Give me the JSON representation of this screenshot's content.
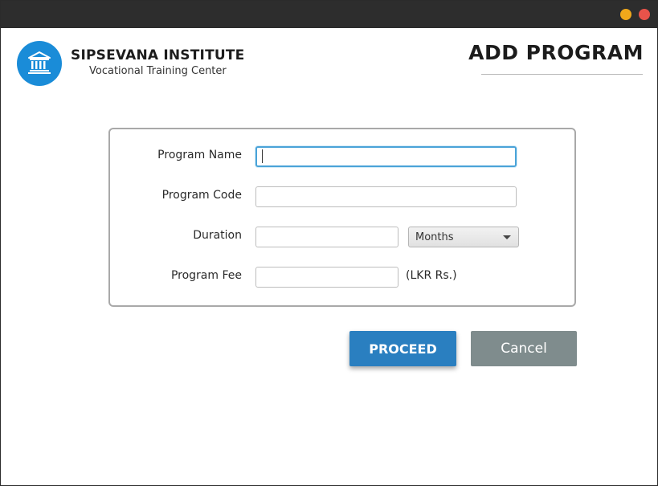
{
  "window": {
    "controls": [
      "minimize",
      "close"
    ],
    "colors": {
      "minimize": "#f0a81b",
      "close": "#e8534a",
      "titlebar": "#2d2d2d"
    }
  },
  "header": {
    "logo_icon": "institute-building-icon",
    "brand_name": "SIPSEVANA INSTITUTE",
    "brand_subtitle": "Vocational Training Center",
    "page_title": "ADD PROGRAM"
  },
  "form": {
    "program_name": {
      "label": "Program Name",
      "value": ""
    },
    "program_code": {
      "label": "Program Code",
      "value": ""
    },
    "duration": {
      "label": "Duration",
      "value": "",
      "unit_selected": "Months"
    },
    "program_fee": {
      "label": "Program Fee",
      "value": "",
      "currency": "(LKR Rs.)"
    }
  },
  "actions": {
    "proceed_label": "PROCEED",
    "cancel_label": "Cancel"
  },
  "colors": {
    "accent": "#1a8cd8",
    "proceed": "#2a7fc0",
    "cancel": "#7f8c8d"
  }
}
